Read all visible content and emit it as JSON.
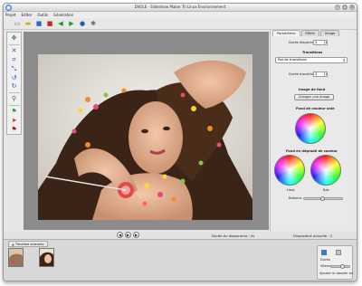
{
  "window": {
    "title": "DVOLE - Slideshow Maker Tri Linux Environnement",
    "controls": [
      "–",
      "□",
      "×"
    ]
  },
  "menu": [
    "Projet",
    "Editer",
    "Outils",
    "Génération"
  ],
  "toolbar": {
    "icons": [
      "new-file-icon",
      "open-folder-icon",
      "save-icon",
      "export-icon",
      "back-icon",
      "forward-icon",
      "help-icon",
      "settings-icon"
    ]
  },
  "tools": {
    "icons": [
      "move-icon",
      "cut-icon",
      "crop-icon",
      "rotate-left-icon",
      "rotate-right-icon",
      "zoom-icon",
      "flag-icon",
      "marker-icon"
    ]
  },
  "panel": {
    "tabs": [
      "Paramètres",
      "Effets",
      "Virage"
    ],
    "duree_label": "Durée diaporama",
    "duree_value": "3",
    "transitions_label": "Transitions",
    "transition_value": "Pas de transitions",
    "duree_transition_label": "Durée transition",
    "duree_transition_value": "3",
    "image_de_fond_label": "Image de fond",
    "charger_button": "Charger une image",
    "fond_uni_label": "Fond de couleur unie",
    "fond_degrade_label": "Fond en dégradé de couleur",
    "haut_label": "Haut",
    "bas_label": "Bas",
    "balance_label": "Balance"
  },
  "status": {
    "timeline_tab": "Timeline scenario",
    "duree_diaporama": "Durée du diaporama : 0s",
    "dispositive": "Dispositive actuelle : 2"
  },
  "bottom_panel": {
    "label1": "Durée",
    "label2": "Vitesse",
    "footer": "Ajouter le dossier en"
  }
}
